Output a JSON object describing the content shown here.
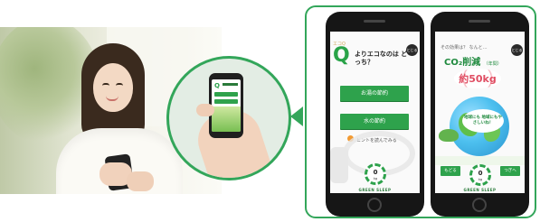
{
  "quiz_screen": {
    "q_small_label": "エコQ",
    "q_letter": "Q",
    "question": "よりエコなのは どっち？",
    "close_label": "とじる",
    "option_1": "お湯の節約",
    "option_2": "水の節約",
    "hint": "ヒントを読んでみる",
    "gauge_value": "0",
    "gauge_unit": "kg",
    "app_name": "GREEN SLEEP"
  },
  "result_screen": {
    "top_text": "その効果は？ なんと…",
    "title": "CO₂削減",
    "title_sub": "（年間）",
    "close_label": "とじる",
    "amount": "約50kg",
    "bubble_text": "地球にも 地域にもやさしいね！",
    "gauge_value": "0",
    "gauge_unit": "kg",
    "left_button": "もどる",
    "right_button": "つぎへ",
    "app_name": "GREEN SLEEP"
  },
  "zoom_phone": {
    "q_letter": "Q"
  },
  "colors": {
    "accent_green": "#33a65a",
    "button_green": "#2ea24c",
    "amount_red": "#e04e63"
  }
}
